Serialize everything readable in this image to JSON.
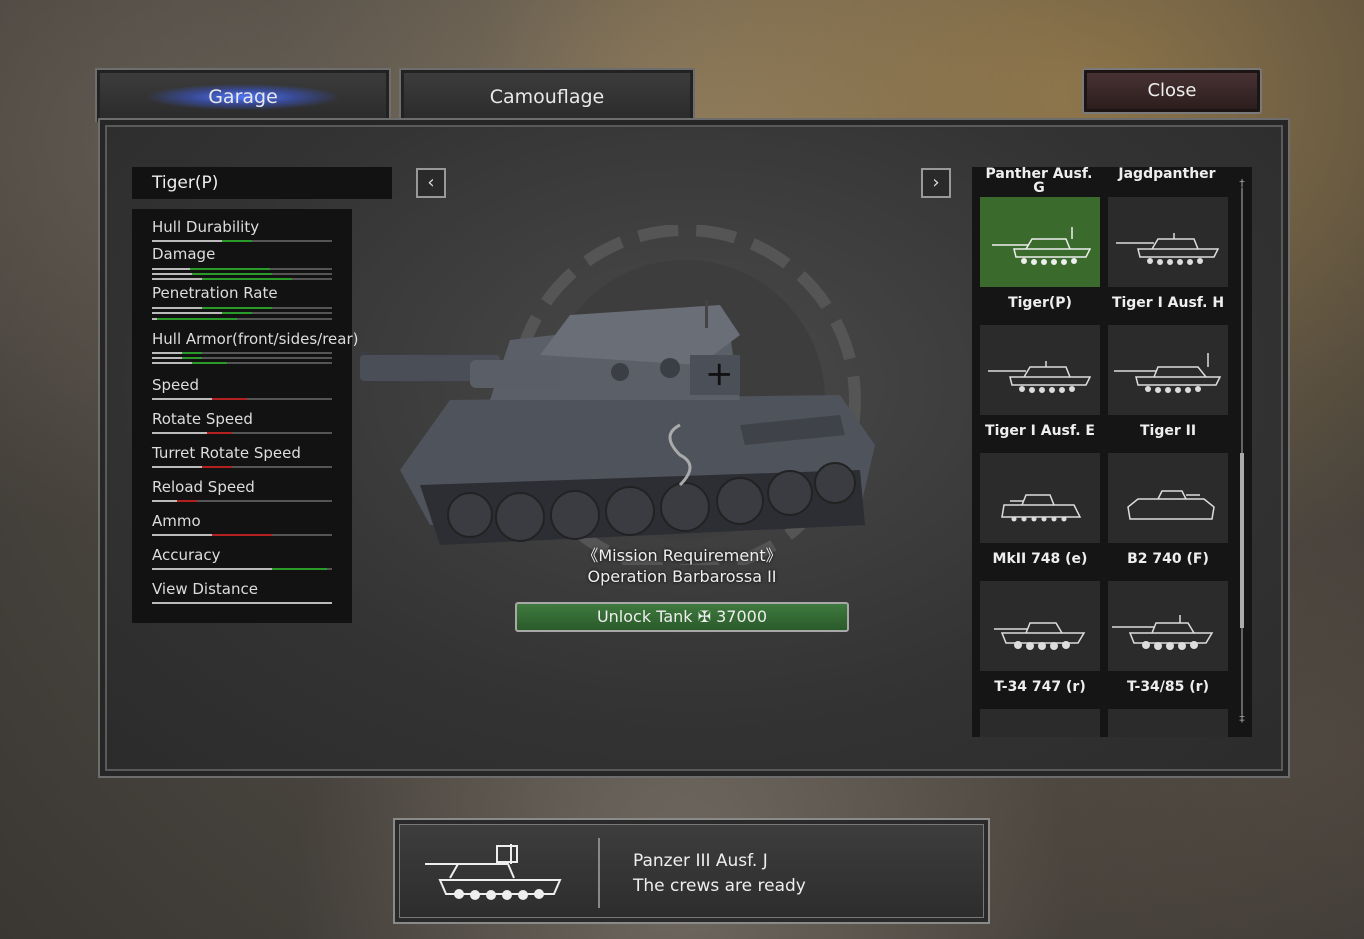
{
  "tabs": {
    "garage_label": "Garage",
    "camouflage_label": "Camouflage",
    "close_label": "Close"
  },
  "selected_tank": {
    "name": "Tiger(P)"
  },
  "stats": [
    {
      "label": "Hull Durability"
    },
    {
      "label": "Damage"
    },
    {
      "label": "Penetration Rate"
    },
    {
      "label": "Hull Armor(front/sides/rear)"
    },
    {
      "label": "Speed"
    },
    {
      "label": "Rotate Speed"
    },
    {
      "label": "Turret Rotate Speed"
    },
    {
      "label": "Reload Speed"
    },
    {
      "label": "Ammo"
    },
    {
      "label": "Accuracy"
    },
    {
      "label": "View Distance"
    }
  ],
  "nav": {
    "prev_icon": "chevron-left-icon",
    "next_icon": "chevron-right-icon"
  },
  "mission": {
    "line1": "《Mission Requirement》",
    "line2": "Operation Barbarossa II"
  },
  "unlock": {
    "label": "Unlock Tank",
    "cost_icon": "iron-cross-icon",
    "cost": "37000"
  },
  "tank_list": {
    "header_left": "Panther Ausf. G",
    "header_right": "Jagdpanther",
    "tanks": [
      {
        "name": "Tiger(P)"
      },
      {
        "name": "Tiger I Ausf. H"
      },
      {
        "name": "Tiger I Ausf. E"
      },
      {
        "name": "Tiger II"
      },
      {
        "name": "MkII 748 (e)"
      },
      {
        "name": "B2 740 (F)"
      },
      {
        "name": "T-34 747 (r)"
      },
      {
        "name": "T-34/85 (r)"
      }
    ]
  },
  "notification": {
    "tank": "Panzer III Ausf. J",
    "message": "The crews are ready"
  },
  "colors": {
    "selected_tile": "#3a6a2c",
    "unlock_button": "#2f6a2f",
    "tab_glow": "#4a6cff"
  }
}
